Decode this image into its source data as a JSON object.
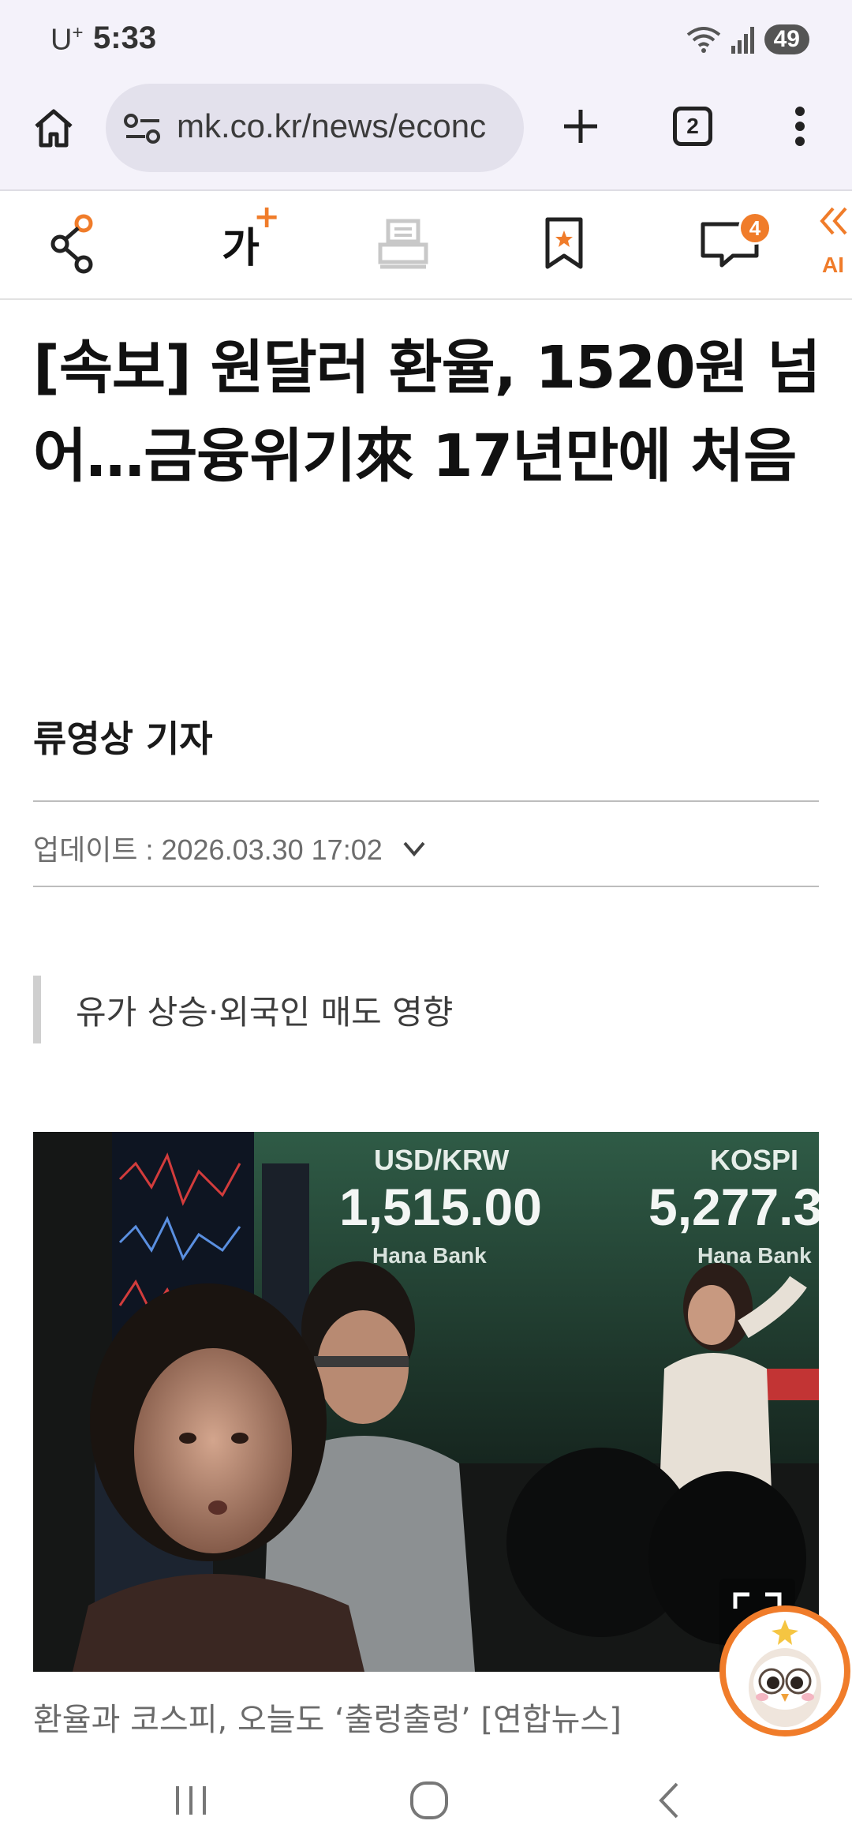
{
  "status_bar": {
    "carrier": "U",
    "carrier_sup": "+",
    "time": "5:33",
    "battery": "49"
  },
  "browser": {
    "url": "mk.co.kr/news/econc",
    "tab_count": "2"
  },
  "article_toolbar": {
    "font_size_label": "가",
    "font_size_plus": "+",
    "comment_count": "4",
    "ai_label": "AI"
  },
  "article": {
    "headline": "[속보] 원달러 환율, 1520원 넘어…금융위기來 17년만에 처음",
    "reporter": "류영상 기자",
    "update": "업데이트 : 2026.03.30 17:02",
    "subheading": "유가 상승·외국인 매도 영향",
    "caption": "환율과 코스피, 오늘도 ‘출렁출렁’ [연합뉴스]",
    "photo": {
      "board_left_label": "USD/KRW",
      "board_left_value": "1,515.00",
      "board_left_brand": "Hana Bank",
      "board_right_label": "KOSPI",
      "board_right_value": "5,277.3",
      "board_right_brand": "Hana Bank"
    }
  },
  "colors": {
    "accent": "#f07c2a",
    "chrome_bg": "#f4f2fa",
    "url_bg": "#e3e1ec"
  }
}
